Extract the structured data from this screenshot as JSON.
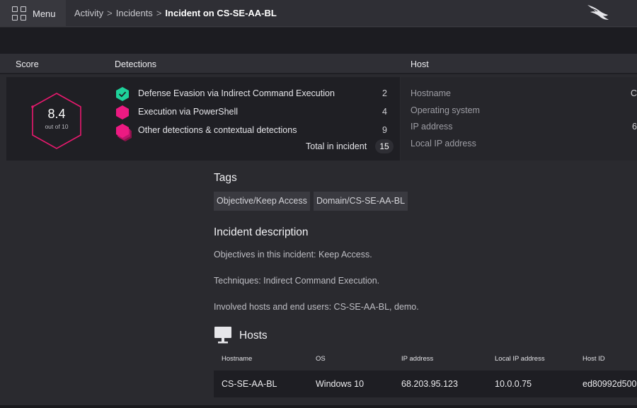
{
  "topbar": {
    "menu_label": "Menu",
    "breadcrumb": [
      "Activity",
      "Incidents"
    ],
    "breadcrumb_current": "Incident on CS-SE-AA-BL",
    "separator": ">"
  },
  "columns": {
    "score": "Score",
    "detections": "Detections",
    "host": "Host"
  },
  "score": {
    "value": "8.4",
    "subtitle": "out of 10",
    "color": "#e8196e"
  },
  "detections": {
    "items": [
      {
        "label": "Defense Evasion via Indirect Command Execution",
        "count": "2",
        "icon": "check-hexagon-icon",
        "color": "#1ed29a"
      },
      {
        "label": "Execution via PowerShell",
        "count": "4",
        "icon": "hexagon-icon",
        "color": "#ec1a82"
      },
      {
        "label": "Other detections & contextual detections",
        "count": "9",
        "icon": "stacked-hexagon-icon",
        "color": "#ec1a82"
      }
    ],
    "total_label": "Total in incident",
    "total_count": "15"
  },
  "host_panel": {
    "rows": [
      {
        "label": "Hostname",
        "value": "C"
      },
      {
        "label": "Operating system",
        "value": ""
      },
      {
        "label": "IP address",
        "value": "6"
      },
      {
        "label": "Local IP address",
        "value": ""
      }
    ]
  },
  "tags": {
    "heading": "Tags",
    "items": [
      "Objective/Keep Access",
      "Domain/CS-SE-AA-BL"
    ]
  },
  "description": {
    "heading": "Incident description",
    "lines": [
      "Objectives in this incident: Keep Access.",
      "Techniques: Indirect Command Execution.",
      "Involved hosts and end users: CS-SE-AA-BL, demo."
    ]
  },
  "hosts": {
    "heading": "Hosts",
    "columns": [
      "Hostname",
      "OS",
      "IP address",
      "Local IP address",
      "Host ID"
    ],
    "rows": [
      {
        "hostname": "CS-SE-AA-BL",
        "os": "Windows 10",
        "ip": "68.203.95.123",
        "local_ip": "10.0.0.75",
        "host_id": "ed80992d500"
      }
    ]
  }
}
